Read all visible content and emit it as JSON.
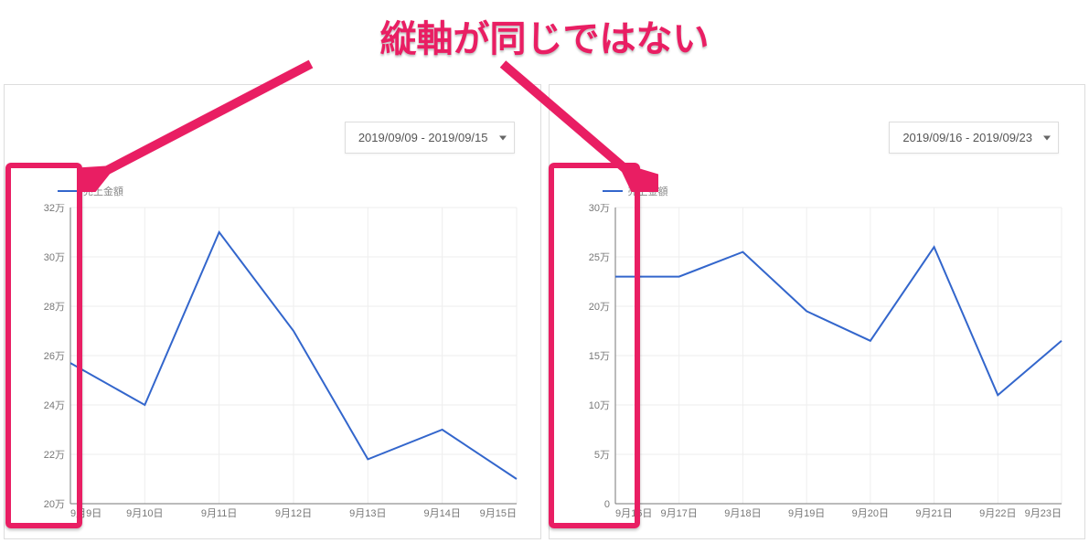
{
  "annotation": "縦軸が同じではない",
  "legend_label": "売上金額",
  "colors": {
    "accent": "#e91e63",
    "series": "#3366cc"
  },
  "panels": [
    {
      "date_range": "2019/09/09 - 2019/09/15"
    },
    {
      "date_range": "2019/09/16 - 2019/09/23"
    }
  ],
  "chart_data": [
    {
      "type": "line",
      "title": "",
      "xlabel": "",
      "ylabel": "",
      "legend": [
        "売上金額"
      ],
      "categories": [
        "9月9日",
        "9月10日",
        "9月11日",
        "9月12日",
        "9月13日",
        "9月14日",
        "9月15日"
      ],
      "values": [
        25.7,
        24.0,
        31.0,
        27.0,
        21.8,
        23.0,
        21.0
      ],
      "y_ticks": [
        20,
        22,
        24,
        26,
        28,
        30,
        32
      ],
      "y_tick_labels": [
        "20万",
        "22万",
        "24万",
        "26万",
        "28万",
        "30万",
        "32万"
      ],
      "ylim": [
        20,
        32
      ],
      "value_unit": "万"
    },
    {
      "type": "line",
      "title": "",
      "xlabel": "",
      "ylabel": "",
      "legend": [
        "売上金額"
      ],
      "categories": [
        "9月16日",
        "9月17日",
        "9月18日",
        "9月19日",
        "9月20日",
        "9月21日",
        "9月22日",
        "9月23日"
      ],
      "values": [
        23.0,
        23.0,
        25.5,
        19.5,
        16.5,
        26.0,
        11.0,
        16.5
      ],
      "y_ticks": [
        0,
        5,
        10,
        15,
        20,
        25,
        30
      ],
      "y_tick_labels": [
        "0",
        "5万",
        "10万",
        "15万",
        "20万",
        "25万",
        "30万"
      ],
      "ylim": [
        0,
        30
      ],
      "value_unit": "万"
    }
  ]
}
